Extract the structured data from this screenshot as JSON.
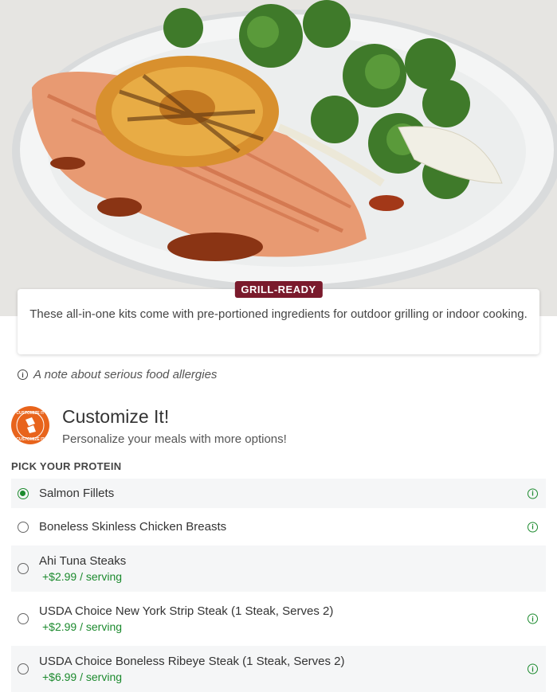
{
  "hero": {
    "badge": "GRILL-READY",
    "description": "These all-in-one kits come with pre-portioned ingredients for outdoor grilling or indoor cooking."
  },
  "allergy": {
    "icon": "info-icon",
    "text": "A note about serious food allergies"
  },
  "customize": {
    "logo_text": "CUSTOMIZE IT",
    "title": "Customize It!",
    "subtitle": "Personalize your meals with more options!",
    "pick_label": "PICK YOUR PROTEIN"
  },
  "options": [
    {
      "name": "Salmon Fillets",
      "price": "",
      "selected": true,
      "info": true,
      "shaded": true
    },
    {
      "name": "Boneless Skinless Chicken Breasts",
      "price": "",
      "selected": false,
      "info": true,
      "shaded": false
    },
    {
      "name": "Ahi Tuna Steaks",
      "price": "+$2.99 / serving",
      "selected": false,
      "info": false,
      "shaded": true
    },
    {
      "name": "USDA Choice New York Strip Steak (1 Steak, Serves 2)",
      "price": "+$2.99 / serving",
      "selected": false,
      "info": true,
      "shaded": false
    },
    {
      "name": "USDA Choice Boneless Ribeye Steak (1 Steak, Serves 2)",
      "price": "+$6.99 / serving",
      "selected": false,
      "info": true,
      "shaded": true
    }
  ],
  "colors": {
    "badge": "#7a1a2c",
    "accent_green": "#1c8a2e",
    "logo_orange": "#e8641c"
  }
}
